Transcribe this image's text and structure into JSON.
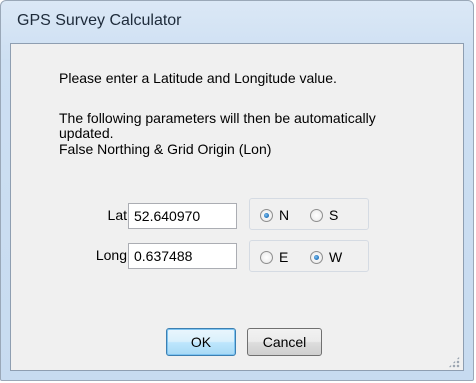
{
  "window": {
    "title": "GPS Survey Calculator"
  },
  "instructions": {
    "line1": "Please enter a Latitude and Longitude value.",
    "line2": "The following parameters will then be automatically",
    "line3": "updated.",
    "line4": "False Northing & Grid Origin (Lon)"
  },
  "lat": {
    "label": "Lat",
    "value": "52.640970",
    "options": [
      {
        "label": "N",
        "checked": true
      },
      {
        "label": "S",
        "checked": false
      }
    ]
  },
  "long": {
    "label": "Long",
    "value": "0.637488",
    "options": [
      {
        "label": "E",
        "checked": false
      },
      {
        "label": "W",
        "checked": true
      }
    ]
  },
  "buttons": {
    "ok": "OK",
    "cancel": "Cancel"
  }
}
